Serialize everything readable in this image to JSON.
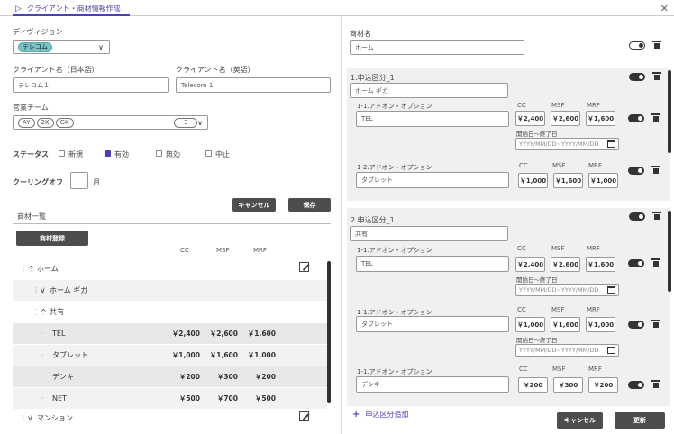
{
  "tab": {
    "label": "クライアント・商材情報作成"
  },
  "left": {
    "division": {
      "label": "ディヴィジョン",
      "value": "テレコム"
    },
    "client_jp": {
      "label": "クライアント名（日本語）",
      "value": "テレコム１"
    },
    "client_en": {
      "label": "クライアント名（英語）",
      "value": "Telecom 1"
    },
    "sales_team": {
      "label": "営業チーム",
      "chips": [
        "AY",
        "2K",
        "GK"
      ],
      "count": "3"
    },
    "status": {
      "label": "ステータス",
      "options": [
        "新規",
        "有効",
        "無効",
        "中止"
      ],
      "checked_index": 1
    },
    "cooling": {
      "label": "クーリングオフ",
      "unit": "月",
      "value": ""
    },
    "cancel_label": "キャンセル",
    "save_label": "保存",
    "product_list_title": "商材一覧",
    "register_label": "商材登録",
    "columns": [
      "CC",
      "MSF",
      "MRF"
    ],
    "rows": [
      {
        "label": "ホーム",
        "toggle": "^",
        "cc": "",
        "msf": "",
        "mrf": ""
      },
      {
        "label": "ホーム ギガ",
        "toggle": "v",
        "cc": "",
        "msf": "",
        "mrf": ""
      },
      {
        "label": "共有",
        "toggle": "^",
        "cc": "",
        "msf": "",
        "mrf": ""
      },
      {
        "label": "TEL",
        "toggle": "",
        "cc": "￥2,400",
        "msf": "￥2,600",
        "mrf": "￥1,600"
      },
      {
        "label": "タブレット",
        "toggle": "",
        "cc": "￥1,000",
        "msf": "￥1,600",
        "mrf": "￥1,000"
      },
      {
        "label": "デンキ",
        "toggle": "",
        "cc": "￥200",
        "msf": "￥300",
        "mrf": "￥200"
      },
      {
        "label": "NET",
        "toggle": "",
        "cc": "￥500",
        "msf": "￥700",
        "mrf": "￥500"
      },
      {
        "label": "マンション",
        "toggle": "v",
        "cc": "",
        "msf": "",
        "mrf": ""
      }
    ]
  },
  "right": {
    "product_name_label": "商材名",
    "product_name_value": "ホーム",
    "section1": {
      "title": "1.申込区分_1",
      "value": "ホーム ギガ",
      "options": [
        {
          "label": "1-1.アドオン・オプション",
          "value": "TEL",
          "cc": "￥2,400",
          "msf": "￥2,600",
          "mrf": "￥1,600",
          "date_label": "開始日～終了日",
          "date_placeholder": "YYYY/MM/DD~YYYY/MM/DD"
        },
        {
          "label": "1-2.アドオン・オプション",
          "value": "タブレット",
          "cc": "￥1,000",
          "msf": "￥1,600",
          "mrf": "￥1,000"
        }
      ]
    },
    "section2": {
      "title": "2.申込区分_1",
      "value": "共有",
      "options": [
        {
          "label": "1-1.アドオン・オプション",
          "value": "TEL",
          "cc": "￥2,400",
          "msf": "￥2,600",
          "mrf": "￥1,600",
          "date_label": "開始日～終了日",
          "date_placeholder": "YYYY/MM/DD~YYYY/MM/DD"
        },
        {
          "label": "1-1.アドオン・オプション",
          "value": "タブレット",
          "cc": "￥1,000",
          "msf": "￥1,600",
          "mrf": "￥1,000",
          "date_label": "開始日～終了日",
          "date_placeholder": "YYYY/MM/DD~YYYY/MM/DD"
        },
        {
          "label": "1-1.アドオン・オプション",
          "value": "デンキ",
          "cc": "￥200",
          "msf": "￥300",
          "mrf": "￥200"
        }
      ]
    },
    "columns": [
      "CC",
      "MSF",
      "MRF"
    ],
    "add_section_label": "申込区分追加",
    "cancel_label": "キャンセル",
    "update_label": "更新"
  }
}
